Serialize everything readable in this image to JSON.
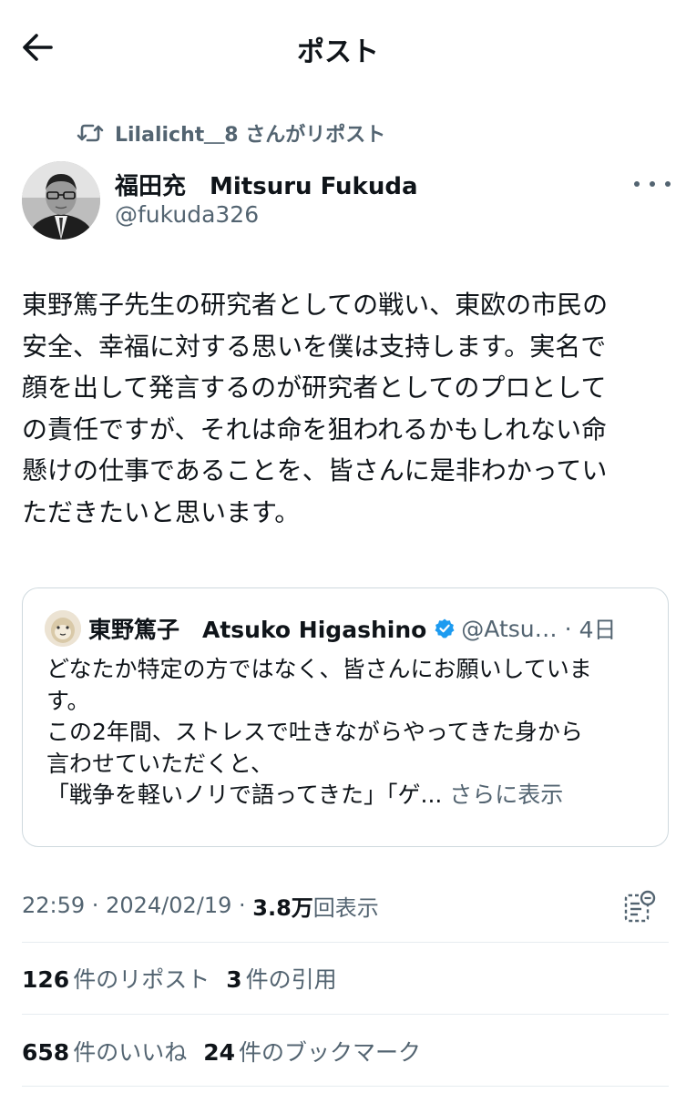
{
  "header": {
    "title": "ポスト"
  },
  "repost": {
    "text": "Lilalicht＿8 さんがリポスト"
  },
  "author": {
    "name": "福田充　Mitsuru Fukuda",
    "handle": "@fukuda326"
  },
  "tweet": {
    "lines": [
      "東野篤子先生の研究者としての戦い、東欧の市民の",
      "安全、幸福に対する思いを僕は支持します。実名で",
      "顔を出して発言するのが研究者としてのプロとして",
      "の責任ですが、それは命を狙われるかもしれない命",
      "懸けの仕事であることを、皆さんに是非わかってい",
      "ただきたいと思います。"
    ]
  },
  "quote": {
    "name": "東野篤子　Atsuko Higashino",
    "handle": "@Atsu…",
    "separator": "·",
    "date": "4日",
    "lines": [
      "どなたか特定の方ではなく、皆さんにお願いしていま",
      "す。",
      "この2年間、ストレスで吐きながらやってきた身から",
      "言わせていただくと、",
      "「戦争を軽いノリで語ってきた」「ゲ..."
    ],
    "show_more": "さらに表示"
  },
  "meta": {
    "time": "22:59",
    "dot": " · ",
    "date": "2024/02/19",
    "views_count": "3.8万",
    "views_label": "回表示"
  },
  "stats_row1": [
    {
      "count": "126",
      "label": "件のリポスト"
    },
    {
      "count": "3",
      "label": "件の引用"
    }
  ],
  "stats_row2": [
    {
      "count": "658",
      "label": "件のいいね"
    },
    {
      "count": "24",
      "label": "件のブックマーク"
    }
  ],
  "icons": {
    "back": "arrow-left-icon",
    "repost": "repost-icon",
    "more": "more-icon",
    "verified": "verified-badge-icon",
    "analytics": "analytics-icon"
  },
  "colors": {
    "text": "#0f1419",
    "secondary": "#536471",
    "border": "#cfd9de",
    "verified": "#1d9bf0"
  }
}
